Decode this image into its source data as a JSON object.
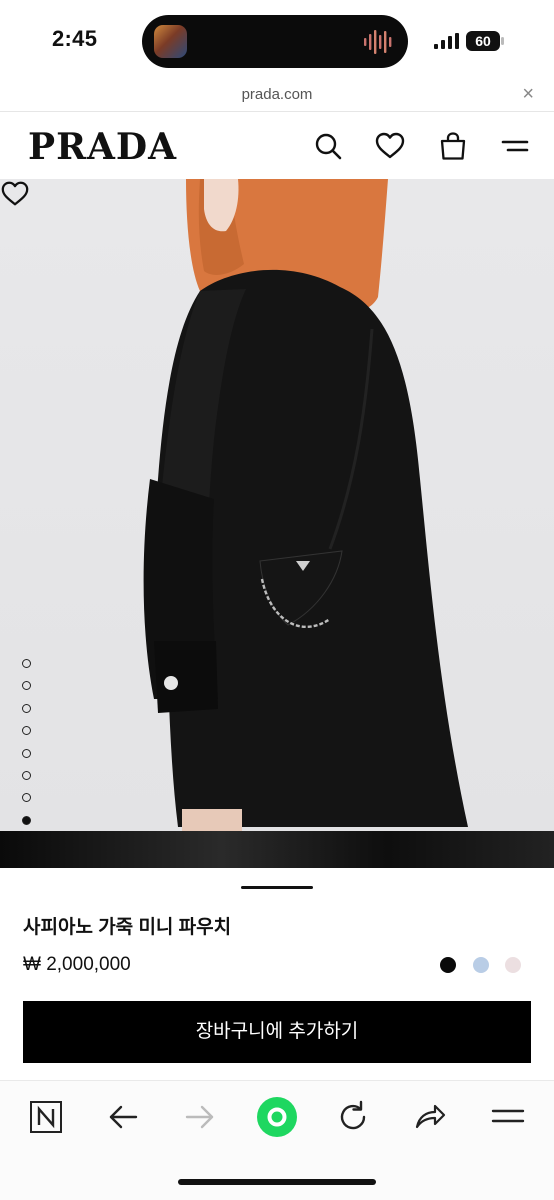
{
  "status_bar": {
    "time": "2:45",
    "battery": "60",
    "icons": [
      "now-playing-thumb-icon",
      "audio-wave-icon",
      "cellular-signal-icon",
      "battery-icon"
    ]
  },
  "browser": {
    "url": "prada.com",
    "close_icon": "×",
    "toolbar_icons": [
      "naver-n-icon",
      "back-arrow-icon",
      "forward-arrow-icon",
      "home-dot-icon",
      "reload-icon",
      "share-icon",
      "menu-icon"
    ]
  },
  "header": {
    "logo": "PRADA",
    "icons": [
      "search-icon",
      "heart-icon",
      "shopping-bag-icon",
      "menu-icon"
    ]
  },
  "gallery": {
    "total_images": 8,
    "active_index": 8,
    "wishlist_icon": "heart-outline-icon"
  },
  "product": {
    "name": "사피아노 가죽 미니 파우치",
    "price": "₩ 2,000,000",
    "colors": [
      "#0a0a0a",
      "#b9cde6",
      "#ecdfe1"
    ],
    "selected_color": "#0a0a0a",
    "add_to_cart": "장바구니에 추가하기"
  },
  "theme": {
    "accent": "#000000",
    "home_button": "#1ed760"
  }
}
